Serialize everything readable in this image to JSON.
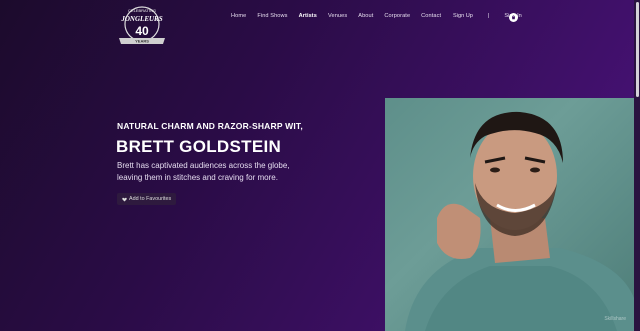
{
  "logo": {
    "line1": "CELEBRATING",
    "name": "JONGLEURS",
    "number": "40",
    "years": "YEARS"
  },
  "nav": [
    {
      "label": "Home",
      "active": false
    },
    {
      "label": "Find Shows",
      "active": false
    },
    {
      "label": "Artists",
      "active": true
    },
    {
      "label": "Venues",
      "active": false
    },
    {
      "label": "About",
      "active": false
    },
    {
      "label": "Corporate",
      "active": false
    },
    {
      "label": "Contact",
      "active": false
    }
  ],
  "auth": {
    "signup": "Sign Up",
    "divider": "|",
    "signin": "Sign In"
  },
  "icons": {
    "cart": "cart-icon",
    "heart": "heart-icon"
  },
  "hero": {
    "kicker": "NATURAL CHARM AND RAZOR-SHARP WIT,",
    "title": "BRETT GOLDSTEIN",
    "description": "Brett has captivated audiences across the globe, leaving them in stitches and craving for more.",
    "favourite_label": "Add to Favourites"
  },
  "photo": {
    "watermark": "Skillshare"
  },
  "colors": {
    "background": "#2a0c46",
    "accent": "#4d1380",
    "photo_bg": "#6d9d97"
  }
}
